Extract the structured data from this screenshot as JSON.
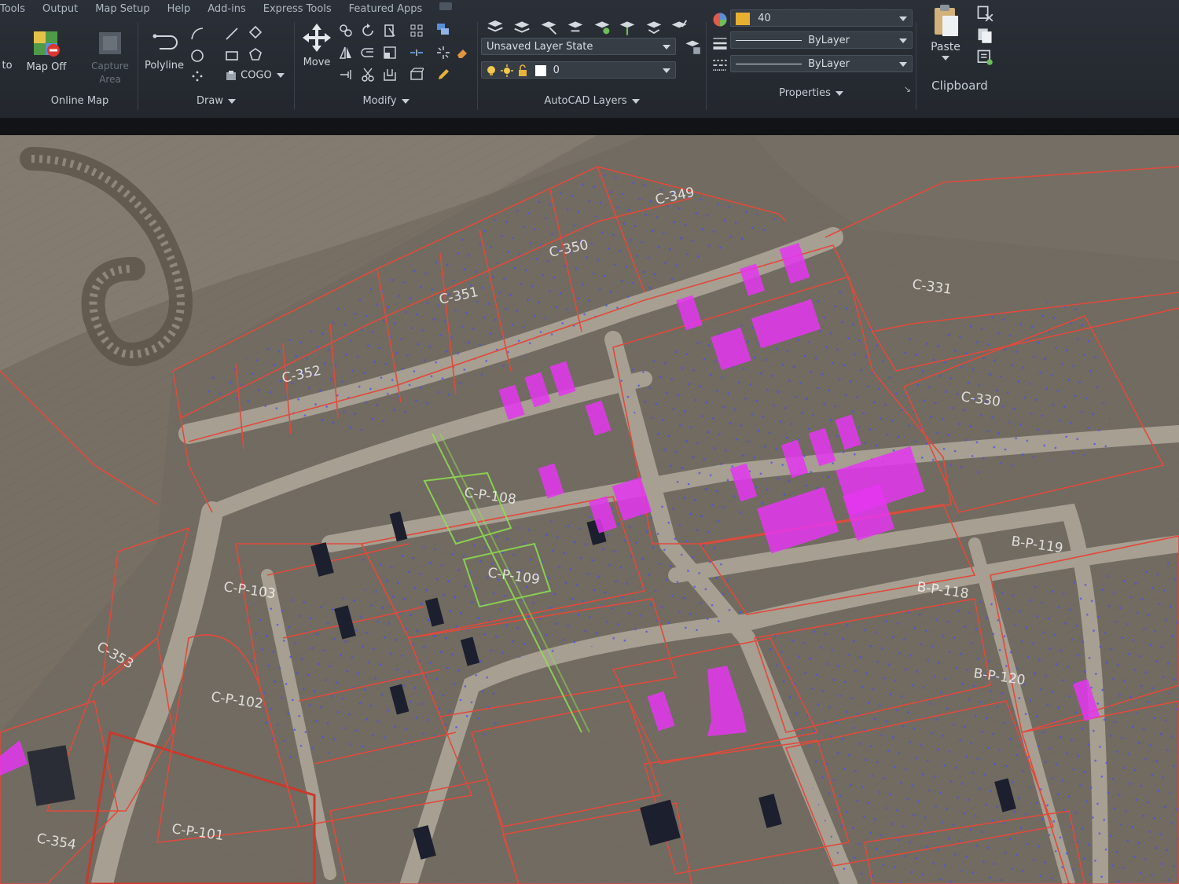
{
  "tabs": [
    "Tools",
    "Output",
    "Map Setup",
    "Help",
    "Add-ins",
    "Express Tools",
    "Featured Apps"
  ],
  "panels": {
    "online_map": {
      "title": "Online Map",
      "left_tool": "to",
      "map_off": "Map Off",
      "capture_area": "Capture Area"
    },
    "draw": {
      "title": "Draw",
      "polyline": "Polyline",
      "cogo": "COGO"
    },
    "modify": {
      "title": "Modify",
      "move": "Move"
    },
    "layers": {
      "title": "AutoCAD Layers",
      "layer_state": "Unsaved Layer State",
      "current_layer": "0"
    },
    "properties": {
      "title": "Properties",
      "color": "40",
      "linetype": "ByLayer",
      "lineweight": "ByLayer",
      "color_swatch": "#e8b030"
    },
    "clipboard": {
      "title": "Clipboard",
      "paste": "Paste"
    }
  },
  "map": {
    "colors": {
      "parcel_line": "#e04a3c",
      "highlight": "#e436f0",
      "alignment": "#8fe04f",
      "annotation": "#3a3df5"
    },
    "labels": [
      "C-349",
      "C-350",
      "C-351",
      "C-352",
      "C-331",
      "C-330",
      "B-P-119",
      "B-P-118",
      "B-P-120",
      "C-P-108",
      "C-P-109",
      "C-P-103",
      "C-P-102",
      "C-P-101",
      "C-353",
      "C-354"
    ]
  }
}
